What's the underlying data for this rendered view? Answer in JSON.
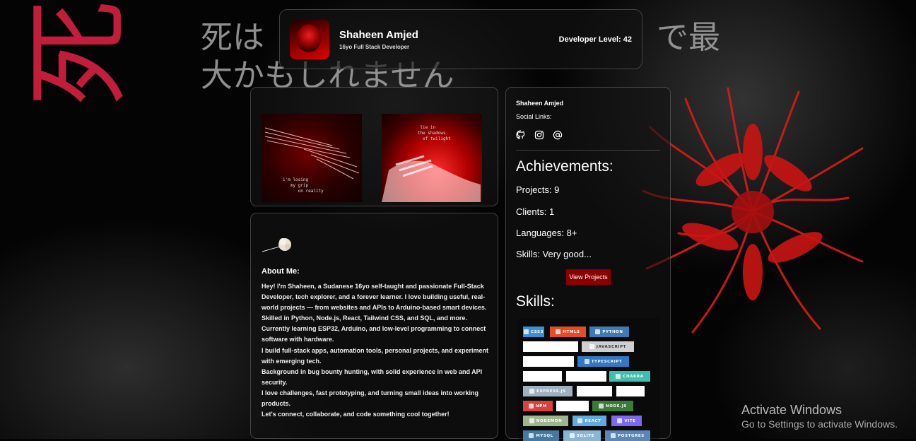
{
  "background": {
    "kanji": "死",
    "quote_line1": "死は",
    "quote_line2": "で最",
    "quote_line3": "大かもしれません",
    "accent_color": "#c21d3a"
  },
  "header": {
    "name": "Shaheen Amjed",
    "subtitle": "16yo Full Stack Developer",
    "level": "Developer Level: 42"
  },
  "gallery": {
    "art1_caption": "i'm losing\n   my grip\n      on reality",
    "art2_caption": "    lie in\n   the shadows\n     of twilight"
  },
  "about": {
    "title": "About Me:",
    "paragraphs": [
      "Hey! I'm Shaheen, a Sudanese 16yo self-taught and passionate Full-Stack Developer, tech explorer, and a forever learner. I love building useful, real-world projects — from websites and APIs to Arduino-based smart devices.",
      "Skilled in Python, Node.js, React, Tailwind CSS, and SQL, and more.",
      "Currently learning ESP32, Arduino, and low-level programming to connect software with hardware.",
      "I build full-stack apps, automation tools, personal projects, and experiment with emerging tech.",
      "Background in bug bounty hunting, with solid experience in web and API security.",
      "I love challenges, fast prototyping, and turning small ideas into working products.",
      "Let's connect, collaborate, and code something cool together!"
    ]
  },
  "profile": {
    "name": "Shaheen Amjed",
    "social_label": "Social Links:",
    "social_icons": [
      "github-icon",
      "instagram-icon",
      "at-sign-icon"
    ]
  },
  "achievements": {
    "title": "Achievements:",
    "projects": "Projects: 9",
    "clients": "Clients: 1",
    "languages": "Languages: 8+",
    "skills": "Skills: Very good...",
    "button": "View Projects",
    "button_color": "#8a0000"
  },
  "skills": {
    "title": "Skills:",
    "badges": [
      {
        "label": "CSS3",
        "color": "#3a8fd6"
      },
      {
        "label": "HTML5",
        "color": "#e34c26"
      },
      {
        "label": "PYTHON",
        "color": "#3e7bb5"
      },
      {
        "label": "",
        "color": "#ffffff"
      },
      {
        "label": "JAVASCRIPT",
        "color": "#cfcfcf"
      },
      {
        "label": "",
        "color": "#ffffff"
      },
      {
        "label": "TYPESCRIPT",
        "color": "#3178c6"
      },
      {
        "label": "",
        "color": "#ffffff"
      },
      {
        "label": "",
        "color": "#ffffff"
      },
      {
        "label": "CHAKRA",
        "color": "#3fbfb0"
      },
      {
        "label": "EXPRESS.JS",
        "color": "#9fb0c0"
      },
      {
        "label": "",
        "color": "#ffffff"
      },
      {
        "label": "",
        "color": "#ffffff"
      },
      {
        "label": "NPM",
        "color": "#d9413f"
      },
      {
        "label": "",
        "color": "#ffffff"
      },
      {
        "label": "NODE.JS",
        "color": "#3c7a3a"
      },
      {
        "label": "NODEMON",
        "color": "#9fb68c"
      },
      {
        "label": "REACT",
        "color": "#61a9e0"
      },
      {
        "label": "VITE",
        "color": "#7d68f0"
      },
      {
        "label": "MYSQL",
        "color": "#4479a1"
      },
      {
        "label": "SQLITE",
        "color": "#8ab6d6"
      },
      {
        "label": "POSTGRES",
        "color": "#5a86b8"
      }
    ]
  },
  "watermark": {
    "line1": "Activate Windows",
    "line2": "Go to Settings to activate Windows."
  }
}
